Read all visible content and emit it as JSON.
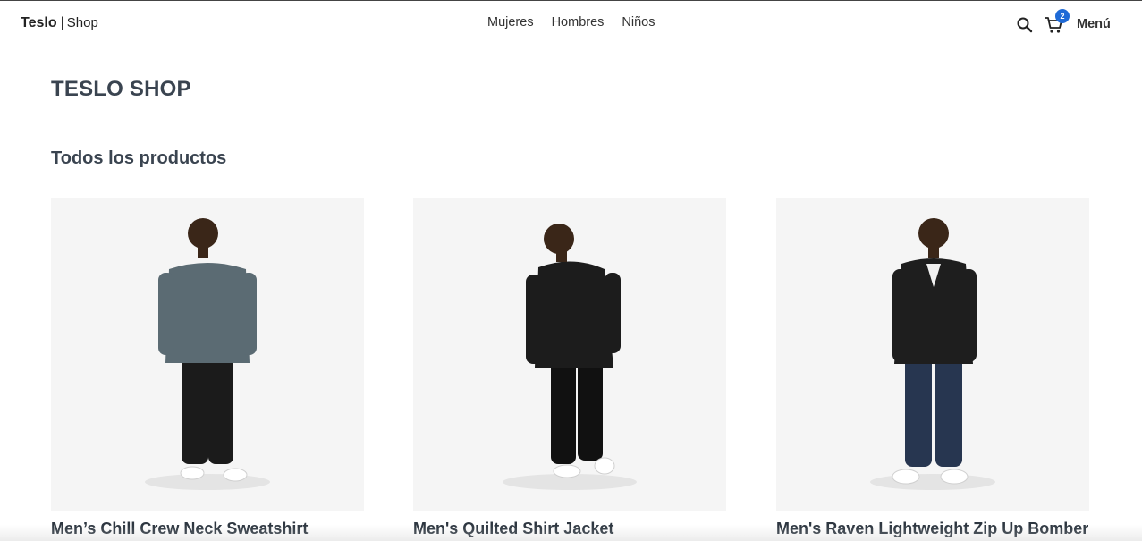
{
  "header": {
    "brand": "Teslo",
    "separator": "|",
    "shop": "Shop",
    "nav": [
      "Mujeres",
      "Hombres",
      "Niños"
    ],
    "cart_count": "2",
    "menu_label": "Menú",
    "icons": {
      "search": "search-icon",
      "cart": "cart-icon"
    }
  },
  "main": {
    "title": "TESLO SHOP",
    "subtitle": "Todos los productos",
    "products": [
      {
        "title": "Men’s Chill Crew Neck Sweatshirt",
        "top_color": "#5b6b73",
        "pants_color": "#1b1b1b"
      },
      {
        "title": "Men's Quilted Shirt Jacket",
        "top_color": "#1c1c1c",
        "pants_color": "#111111"
      },
      {
        "title": "Men's Raven Lightweight Zip Up Bomber",
        "top_color": "#1e1e1e",
        "pants_color": "#273650"
      }
    ]
  },
  "colors": {
    "badge": "#1f6ad6",
    "card_bg": "#f5f5f5",
    "heading": "#3a4450"
  }
}
